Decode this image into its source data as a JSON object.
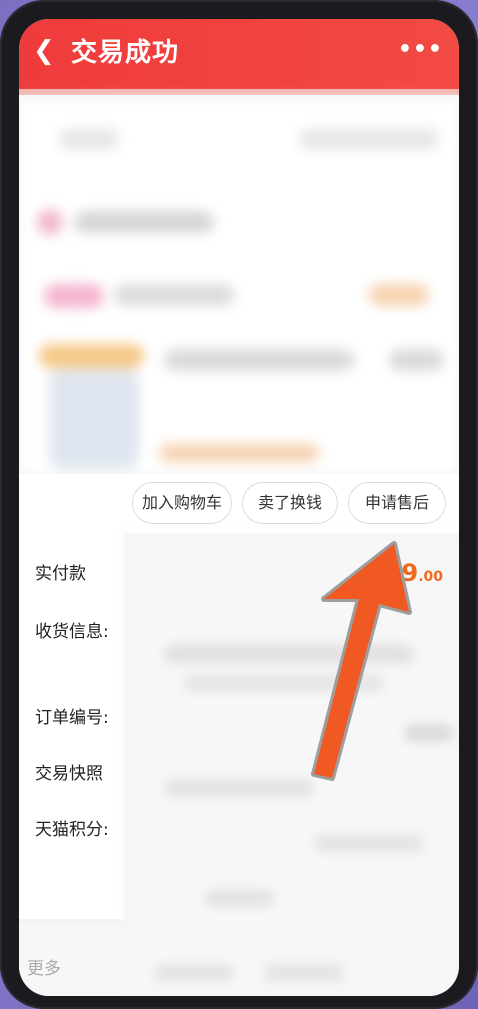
{
  "header": {
    "back_icon": "chevron-left-icon",
    "title": "交易成功",
    "more_icon": "more-dots-icon",
    "more_glyph": "•••"
  },
  "actions": {
    "add_to_cart": "加入购物车",
    "sell_for_cash": "卖了换钱",
    "after_sales": "申请售后"
  },
  "order_info": {
    "paid_label": "实付款",
    "paid_amount_int": "99",
    "paid_amount_dec": ".00",
    "shipping_label": "收货信息:",
    "order_no_label": "订单编号:",
    "snapshot_label": "交易快照",
    "points_label": "天猫积分:"
  },
  "footer": {
    "more": "更多"
  },
  "colors": {
    "header_red": "#ef3b3b",
    "price_orange": "#ef6a1e",
    "arrow_orange": "#f05a22"
  }
}
